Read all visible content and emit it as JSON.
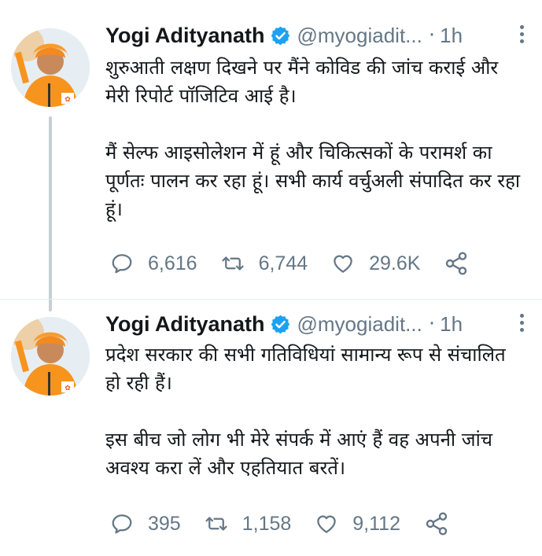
{
  "tweets": [
    {
      "author": {
        "name": "Yogi Adityanath",
        "handle": "@myogiadit...",
        "verified": true
      },
      "time": "1h",
      "paragraphs": [
        "शुरुआती लक्षण दिखने पर मैंने कोविड की जांच कराई और मेरी रिपोर्ट पॉजिटिव आई है।",
        "मैं सेल्फ आइसोलेशन में हूं और चिकित्सकों के परामर्श का पूर्णतः पालन कर रहा हूं। सभी कार्य वर्चुअली संपादित कर रहा हूं।"
      ],
      "stats": {
        "replies": "6,616",
        "retweets": "6,744",
        "likes": "29.6K"
      }
    },
    {
      "author": {
        "name": "Yogi Adityanath",
        "handle": "@myogiadit...",
        "verified": true
      },
      "time": "1h",
      "paragraphs": [
        "प्रदेश सरकार की सभी गतिविधियां सामान्य रूप से संचालित हो रही हैं।",
        "इस बीच जो लोग भी मेरे संपर्क में आएं हैं वह अपनी जांच अवश्य करा लें और एहतियात बरतें।"
      ],
      "stats": {
        "replies": "395",
        "retweets": "1,158",
        "likes": "9,112"
      }
    }
  ],
  "colors": {
    "text": "#14171a",
    "secondary": "#657786",
    "verified": "#1da1f2",
    "thread_line": "#c4cfd6",
    "saffron": "#f7941d"
  },
  "icons": [
    "reply-icon",
    "retweet-icon",
    "like-icon",
    "share-icon",
    "verified-badge-icon",
    "more-options-icon"
  ]
}
